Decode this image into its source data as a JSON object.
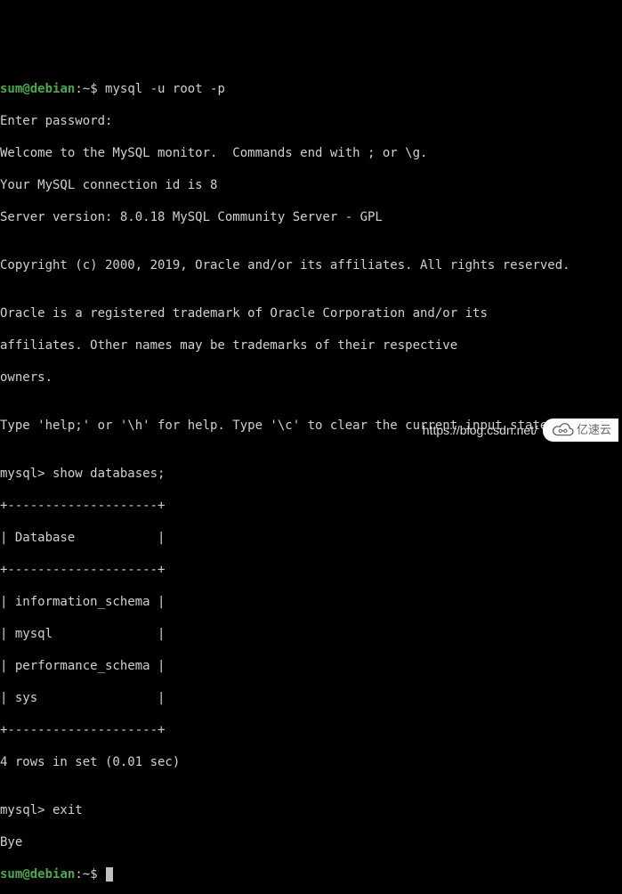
{
  "prompt1": {
    "user": "sum",
    "at": "@",
    "host": "debian",
    "sep": ":",
    "path": "~",
    "sym": "$ ",
    "cmd": "mysql -u root -p"
  },
  "lines": {
    "l1": "Enter password:",
    "l2": "Welcome to the MySQL monitor.  Commands end with ; or \\g.",
    "l3": "Your MySQL connection id is 8",
    "l4": "Server version: 8.0.18 MySQL Community Server - GPL",
    "l5": "",
    "l6": "Copyright (c) 2000, 2019, Oracle and/or its affiliates. All rights reserved.",
    "l7": "",
    "l8": "Oracle is a registered trademark of Oracle Corporation and/or its",
    "l9": "affiliates. Other names may be trademarks of their respective",
    "l10": "owners.",
    "l11": "",
    "l12": "Type 'help;' or '\\h' for help. Type '\\c' to clear the current input statement.",
    "l13": "",
    "l14": "mysql> show databases;",
    "l15": "+--------------------+",
    "l16": "| Database           |",
    "l17": "+--------------------+",
    "l18": "| information_schema |",
    "l19": "| mysql              |",
    "l20": "| performance_schema |",
    "l21": "| sys                |",
    "l22": "+--------------------+",
    "l23": "4 rows in set (0.01 sec)",
    "l24": "",
    "l25": "mysql> exit",
    "l26": "Bye"
  },
  "prompt2": {
    "user": "sum",
    "at": "@",
    "host": "debian",
    "sep": ":",
    "path": "~",
    "sym": "$ "
  },
  "watermark": {
    "url": "https://blog.csdn.net/",
    "brand": "亿速云"
  }
}
